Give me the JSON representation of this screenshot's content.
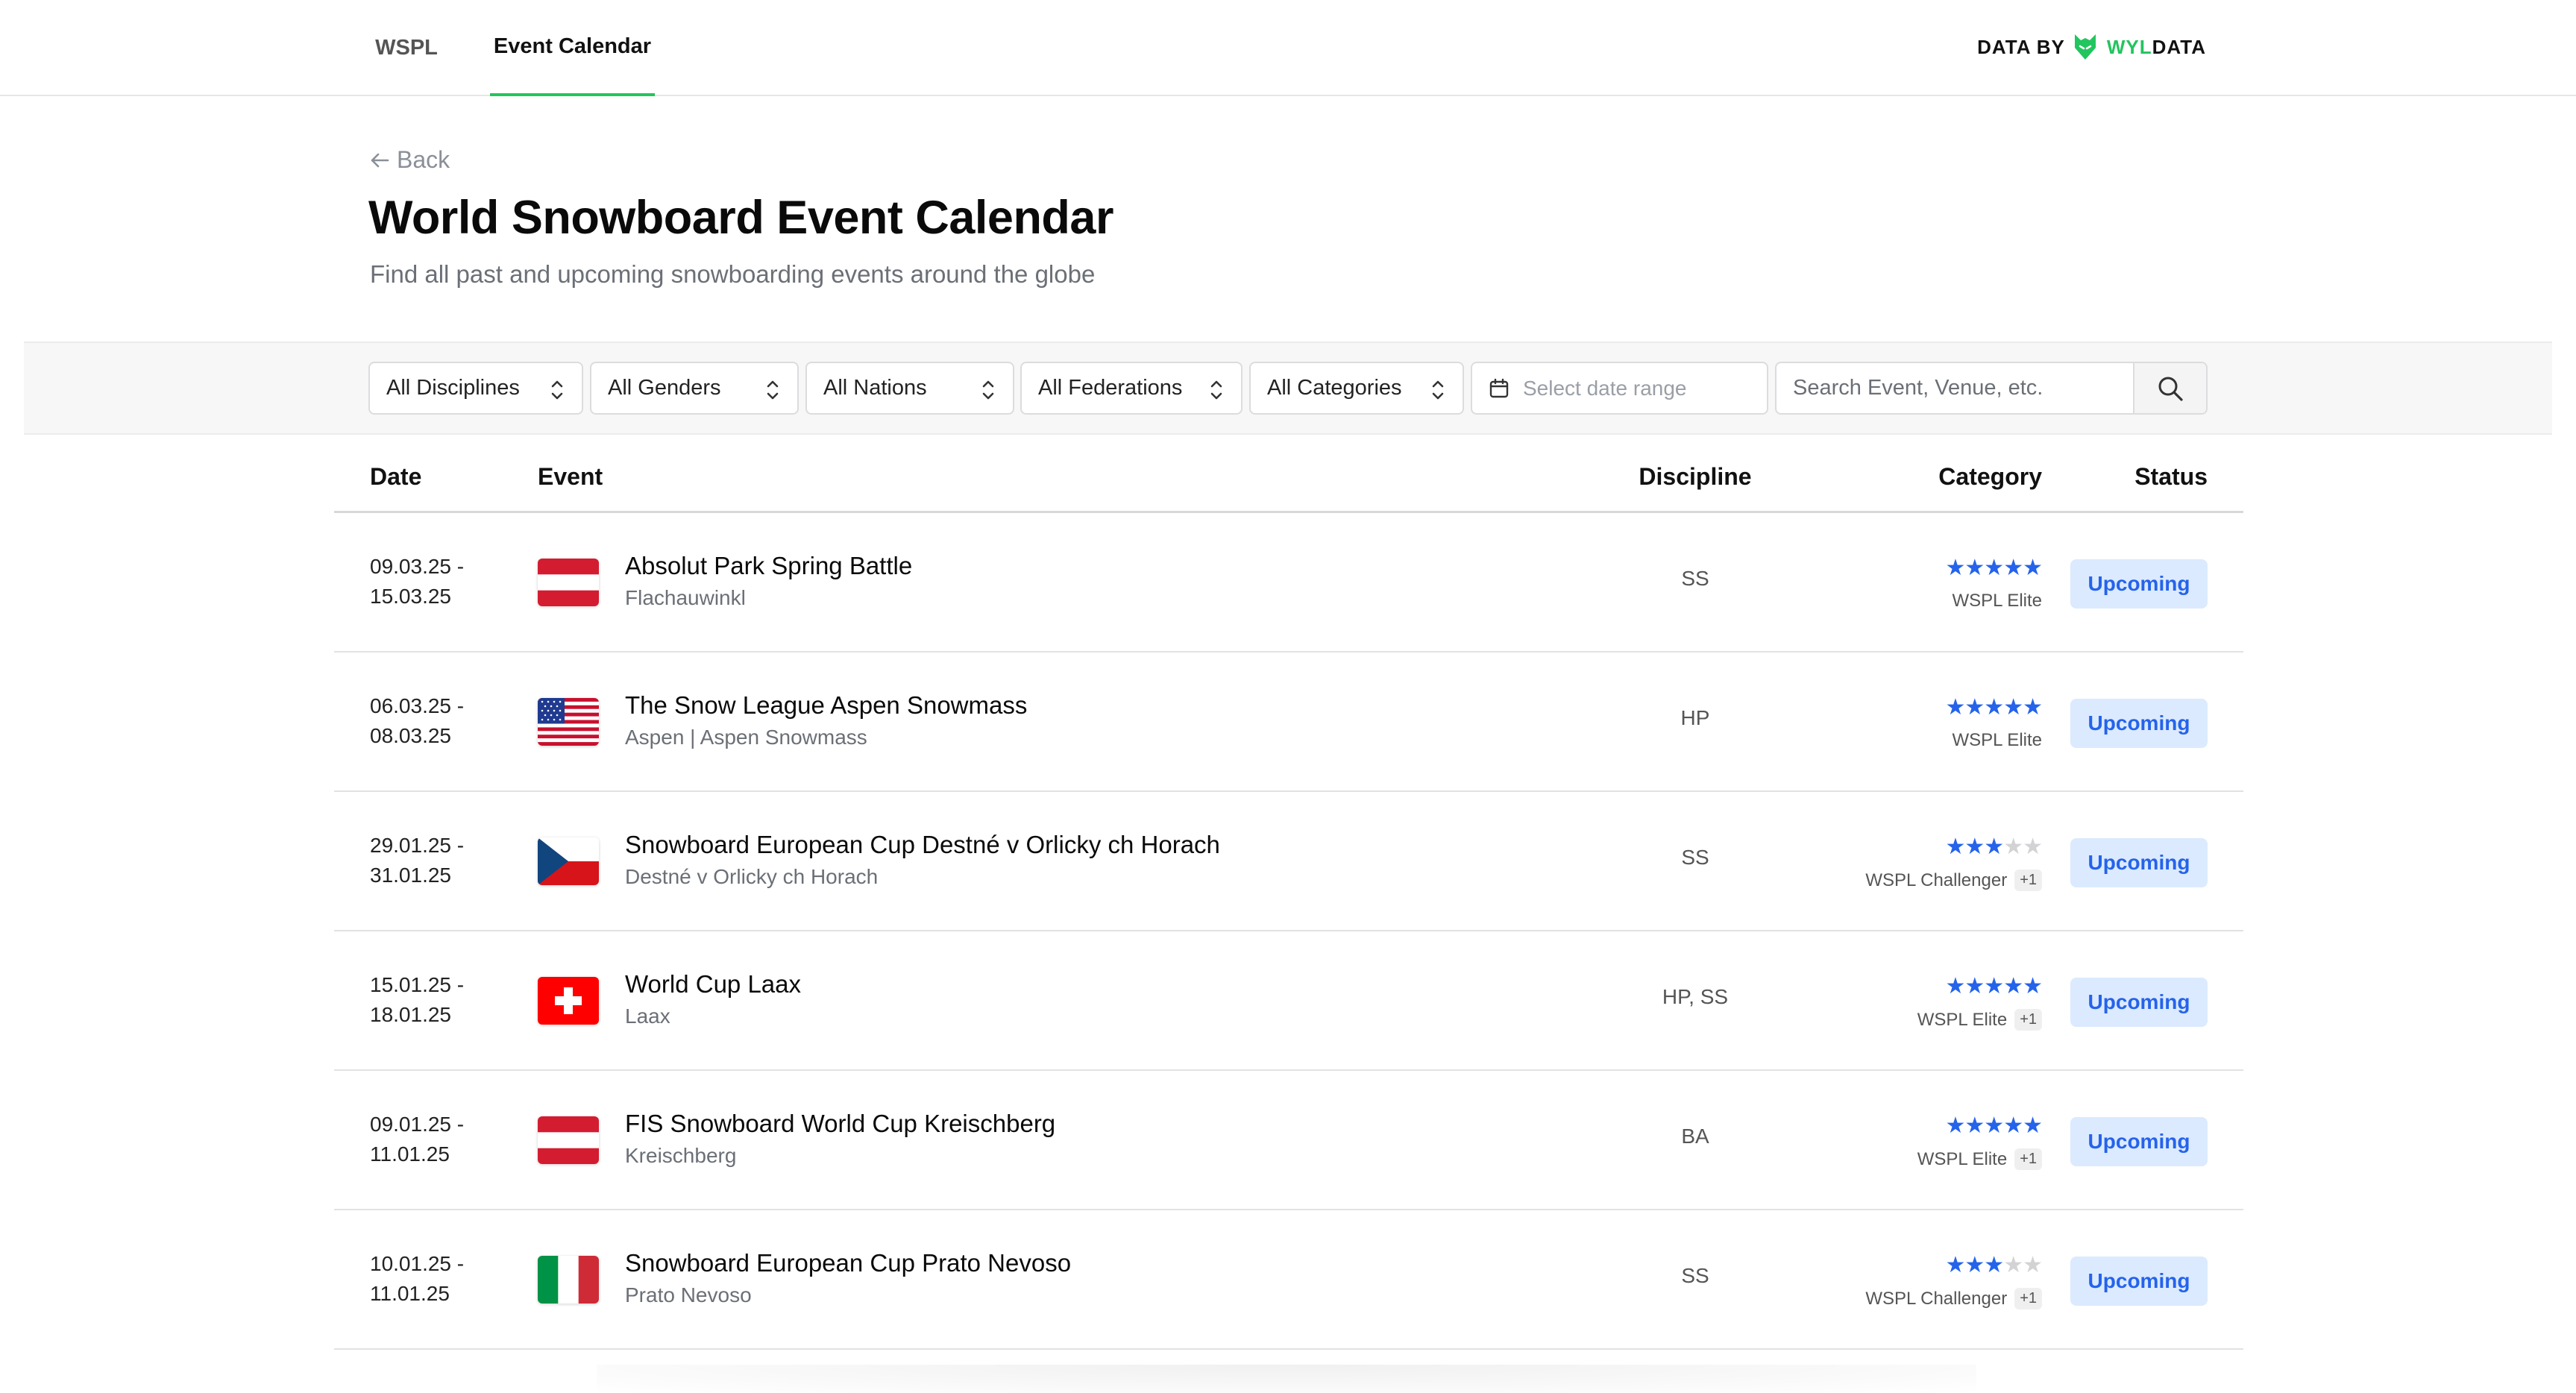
{
  "nav": {
    "tabs": [
      {
        "label": "WSPL"
      },
      {
        "label": "Event Calendar",
        "active": true
      }
    ],
    "brand": {
      "data_by": "DATA BY",
      "wyl": "WYL",
      "data": "DATA",
      "accent_color": "#22c55e",
      "icon": "wolf-logo-icon"
    }
  },
  "header": {
    "back_label": "Back",
    "title": "World Snowboard Event Calendar",
    "subtitle": "Find all past and upcoming snowboarding events around the globe"
  },
  "filters": {
    "disciplines": "All Disciplines",
    "genders": "All Genders",
    "nations": "All Nations",
    "federations": "All Federations",
    "categories": "All Categories",
    "date_placeholder": "Select date range",
    "search_placeholder": "Search Event, Venue, etc."
  },
  "table": {
    "headers": {
      "date": "Date",
      "event": "Event",
      "discipline": "Discipline",
      "category": "Category",
      "status": "Status"
    },
    "rows": [
      {
        "date_start": "09.03.25 -",
        "date_end": "15.03.25",
        "flag": "austria",
        "name": "Absolut Park Spring Battle",
        "venue": "Flachauwinkl",
        "discipline": "SS",
        "stars": 5,
        "category": "WSPL Elite",
        "extra": "",
        "status": "Upcoming"
      },
      {
        "date_start": "06.03.25 -",
        "date_end": "08.03.25",
        "flag": "usa",
        "name": "The Snow League Aspen Snowmass",
        "venue": "Aspen | Aspen Snowmass",
        "discipline": "HP",
        "stars": 5,
        "category": "WSPL Elite",
        "extra": "",
        "status": "Upcoming"
      },
      {
        "date_start": "29.01.25 -",
        "date_end": "31.01.25",
        "flag": "czechia",
        "name": "Snowboard European Cup Destné v Orlicky ch Horach",
        "venue": "Destné v Orlicky ch Horach",
        "discipline": "SS",
        "stars": 3,
        "category": "WSPL Challenger",
        "extra": "+1",
        "status": "Upcoming"
      },
      {
        "date_start": "15.01.25 -",
        "date_end": "18.01.25",
        "flag": "switzerland",
        "name": "World Cup Laax",
        "venue": "Laax",
        "discipline": "HP, SS",
        "stars": 5,
        "category": "WSPL Elite",
        "extra": "+1",
        "status": "Upcoming"
      },
      {
        "date_start": "09.01.25 -",
        "date_end": "11.01.25",
        "flag": "austria",
        "name": "FIS Snowboard World Cup Kreischberg",
        "venue": "Kreischberg",
        "discipline": "BA",
        "stars": 5,
        "category": "WSPL Elite",
        "extra": "+1",
        "status": "Upcoming"
      },
      {
        "date_start": "10.01.25 -",
        "date_end": "11.01.25",
        "flag": "italy",
        "name": "Snowboard European Cup Prato Nevoso",
        "venue": "Prato Nevoso",
        "discipline": "SS",
        "stars": 3,
        "category": "WSPL Challenger",
        "extra": "+1",
        "status": "Upcoming"
      }
    ]
  },
  "colors": {
    "accent_green": "#22c55e",
    "star_blue": "#2563eb",
    "badge_bg": "#dbeafe",
    "badge_text": "#2563eb"
  }
}
